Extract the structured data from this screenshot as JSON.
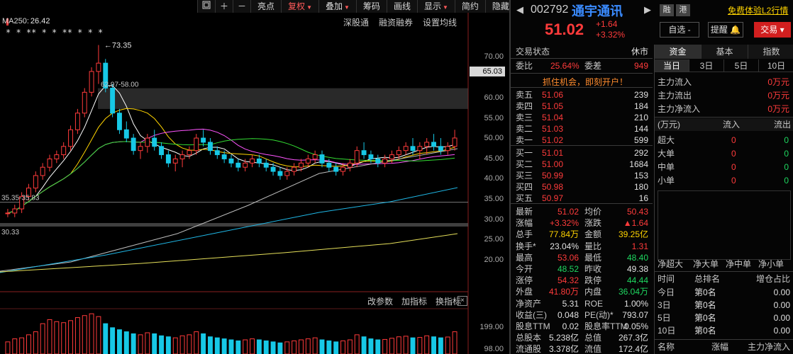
{
  "toolbar": {
    "icons": [
      "window-icon",
      "plus-icon",
      "minus-icon"
    ],
    "items": [
      "亮点",
      "复权",
      "叠加",
      "筹码",
      "画线",
      "显示",
      "简约",
      "隐藏"
    ],
    "highlight_index": 1,
    "dropdown_indices": [
      1,
      2,
      5
    ]
  },
  "chart": {
    "ma_label": "MA250:",
    "ma_value": "26.42",
    "links": [
      "深股通",
      "融资融券",
      "设置均线"
    ],
    "sub_links": [
      "改参数",
      "加指标",
      "换指标"
    ],
    "close_icon": "×",
    "price_tag": "65.03",
    "y_ticks": [
      "70.00",
      "60.00",
      "55.00",
      "50.00",
      "45.00",
      "40.00",
      "35.00",
      "30.00",
      "25.00",
      "20.00"
    ],
    "vol_ticks": [
      "199.00",
      "98.00"
    ],
    "high_annotation": "73.35",
    "gap_label": "62.97-58.00",
    "gap2_label": "35.35-35.83",
    "low_left_label": "30.33",
    "star_marks": "** * * * ** * *"
  },
  "chart_data": {
    "type": "candlestick",
    "ylim": [
      17,
      76
    ],
    "last_price": 65.03,
    "candles": [
      [
        33,
        34,
        32,
        33
      ],
      [
        33,
        35,
        32,
        34
      ],
      [
        34,
        38,
        33,
        37
      ],
      [
        37,
        40,
        36,
        39
      ],
      [
        39,
        43,
        38,
        42
      ],
      [
        42,
        45,
        41,
        44
      ],
      [
        44,
        47,
        43,
        46
      ],
      [
        46,
        48,
        45,
        47
      ],
      [
        47,
        50,
        46,
        49
      ],
      [
        49,
        54,
        48,
        53
      ],
      [
        53,
        58,
        52,
        57
      ],
      [
        57,
        63,
        56,
        62
      ],
      [
        62,
        68,
        61,
        67
      ],
      [
        67,
        73.35,
        64,
        69
      ],
      [
        69,
        70,
        62,
        63
      ],
      [
        63,
        64,
        56,
        57
      ],
      [
        57,
        58,
        52,
        53
      ],
      [
        53,
        55,
        50,
        51
      ],
      [
        51,
        52,
        47,
        48
      ],
      [
        48,
        50,
        46,
        49
      ],
      [
        49,
        52,
        47.5,
        51
      ],
      [
        51,
        53,
        48,
        49
      ],
      [
        49,
        50,
        46,
        47
      ],
      [
        47,
        48,
        44,
        45
      ],
      [
        45,
        47,
        43,
        46
      ],
      [
        46,
        48,
        44,
        47
      ],
      [
        47,
        49,
        46,
        48
      ],
      [
        48,
        52,
        47,
        51
      ],
      [
        51,
        53,
        49,
        50
      ],
      [
        50,
        51,
        47,
        48
      ],
      [
        48,
        49,
        46,
        47
      ],
      [
        47,
        48,
        45,
        46
      ],
      [
        46,
        47,
        44,
        45
      ],
      [
        45,
        46,
        43,
        44
      ],
      [
        44,
        46,
        43,
        45
      ],
      [
        45,
        47,
        44,
        46
      ],
      [
        46,
        47,
        44,
        45
      ],
      [
        45,
        46,
        43,
        44
      ],
      [
        44,
        45,
        42,
        43
      ],
      [
        43,
        44,
        41,
        42
      ],
      [
        42,
        44,
        41,
        43
      ],
      [
        43,
        45,
        42,
        44
      ],
      [
        44,
        46,
        43,
        45
      ],
      [
        45,
        47,
        44,
        46
      ],
      [
        46,
        48,
        45,
        47
      ],
      [
        47,
        48,
        44,
        45
      ],
      [
        45,
        46,
        43,
        44
      ],
      [
        44,
        45,
        42,
        43
      ],
      [
        43,
        45,
        42,
        44
      ],
      [
        44,
        46,
        43,
        45
      ],
      [
        45,
        49,
        44,
        48
      ],
      [
        48,
        50,
        46,
        47
      ],
      [
        47,
        48,
        45,
        46
      ],
      [
        46,
        47,
        44,
        45
      ],
      [
        45,
        47,
        44,
        46
      ],
      [
        46,
        48,
        45,
        47
      ],
      [
        47,
        49,
        46,
        48
      ],
      [
        48,
        50,
        47,
        49
      ],
      [
        49,
        51,
        47,
        48
      ],
      [
        48,
        50,
        46,
        49
      ],
      [
        49,
        51,
        47,
        50
      ],
      [
        50,
        52,
        48,
        49
      ],
      [
        49,
        51,
        47,
        48
      ],
      [
        48,
        50,
        47,
        49
      ],
      [
        49,
        53,
        48,
        51.02
      ]
    ],
    "volumes": [
      60,
      75,
      80,
      95,
      110,
      150,
      170,
      160,
      155,
      165,
      180,
      190,
      199,
      185,
      150,
      130,
      120,
      110,
      100,
      95,
      105,
      100,
      90,
      85,
      80,
      90,
      95,
      110,
      100,
      85,
      80,
      75,
      70,
      65,
      70,
      75,
      70,
      65,
      60,
      55,
      60,
      65,
      70,
      75,
      80,
      70,
      65,
      60,
      65,
      70,
      95,
      85,
      75,
      70,
      72,
      78,
      85,
      88,
      80,
      82,
      90,
      85,
      80,
      84,
      110
    ],
    "series": [
      {
        "name": "MA5",
        "color": "#ffffff"
      },
      {
        "name": "MA10",
        "color": "#ffd400"
      },
      {
        "name": "MA20",
        "color": "#ff55ff"
      },
      {
        "name": "MA30",
        "color": "#33dd33"
      },
      {
        "name": "MA60",
        "color": "#bbbbbb"
      },
      {
        "name": "MA120",
        "color": "#1fb7e6"
      },
      {
        "name": "MA250",
        "color": "#e6e05a"
      }
    ]
  },
  "header": {
    "code": "002792",
    "name": "通宇通讯",
    "btn_rong": "融",
    "btn_gang": "港",
    "free_link": "免费体验L2行情",
    "price": "51.02",
    "change": "+1.64",
    "change_pct": "+3.32%",
    "watch_btn": "自选 -",
    "remind_btn": "提醒",
    "trade_btn": "交易"
  },
  "orderbook": {
    "status_label": "交易状态",
    "status_value": "休市",
    "webi_label": "委比",
    "webi_value": "25.64%",
    "weicha_label": "委差",
    "weicha_value": "949",
    "promo": "抓住机会，即刻开户！",
    "sells": [
      {
        "label": "卖五",
        "price": "51.06",
        "vol": "239"
      },
      {
        "label": "卖四",
        "price": "51.05",
        "vol": "184"
      },
      {
        "label": "卖三",
        "price": "51.04",
        "vol": "210"
      },
      {
        "label": "卖二",
        "price": "51.03",
        "vol": "144"
      },
      {
        "label": "卖一",
        "price": "51.02",
        "vol": "599"
      }
    ],
    "buys": [
      {
        "label": "买一",
        "price": "51.01",
        "vol": "292"
      },
      {
        "label": "买二",
        "price": "51.00",
        "vol": "1684"
      },
      {
        "label": "买三",
        "price": "50.99",
        "vol": "153"
      },
      {
        "label": "买四",
        "price": "50.98",
        "vol": "180"
      },
      {
        "label": "买五",
        "price": "50.97",
        "vol": "16"
      }
    ],
    "quotes": [
      {
        "k1": "最新",
        "v1": "51.02",
        "c1": "red",
        "k2": "均价",
        "v2": "50.43",
        "c2": "red"
      },
      {
        "k1": "涨幅",
        "v1": "+3.32%",
        "c1": "red",
        "k2": "涨跌",
        "v2": "▲1.64",
        "c2": "red"
      },
      {
        "k1": "总手",
        "v1": "77.84万",
        "c1": "ylw",
        "k2": "金额",
        "v2": "39.25亿",
        "c2": "ylw"
      },
      {
        "k1": "换手*",
        "v1": "23.04%",
        "c1": "wht",
        "k2": "量比",
        "v2": "1.31",
        "c2": "red"
      },
      {
        "k1": "最高",
        "v1": "53.06",
        "c1": "red",
        "k2": "最低",
        "v2": "48.40",
        "c2": "grn"
      },
      {
        "k1": "今开",
        "v1": "48.52",
        "c1": "grn",
        "k2": "昨收",
        "v2": "49.38",
        "c2": "wht"
      },
      {
        "k1": "涨停",
        "v1": "54.32",
        "c1": "red",
        "k2": "跌停",
        "v2": "44.44",
        "c2": "grn"
      },
      {
        "k1": "外盘",
        "v1": "41.80万",
        "c1": "red",
        "k2": "内盘",
        "v2": "36.04万",
        "c2": "grn"
      },
      {
        "k1": "净资产",
        "v1": "5.31",
        "c1": "wht",
        "k2": "ROE",
        "v2": "1.00%",
        "c2": "wht"
      },
      {
        "k1": "收益(三)",
        "v1": "0.048",
        "c1": "wht",
        "k2": "PE(动)*",
        "v2": "793.07",
        "c2": "wht"
      },
      {
        "k1": "股息TTM",
        "v1": "0.02",
        "c1": "wht",
        "k2": "股息率TTM",
        "v2": "0.05%",
        "c2": "wht"
      },
      {
        "k1": "总股本",
        "v1": "5.238亿",
        "c1": "wht",
        "k2": "总值",
        "v2": "267.3亿",
        "c2": "wht"
      },
      {
        "k1": "流通股",
        "v1": "3.378亿",
        "c1": "wht",
        "k2": "流值",
        "v2": "172.4亿",
        "c2": "wht"
      }
    ]
  },
  "capflow": {
    "tabs": [
      "资金",
      "基本",
      "指数"
    ],
    "periods": [
      "当日",
      "3日",
      "5日",
      "10日"
    ],
    "flows": [
      {
        "k": "主力流入",
        "v": "0万元"
      },
      {
        "k": "主力流出",
        "v": "0万元"
      },
      {
        "k": "主力净流入",
        "v": "0万元"
      }
    ],
    "grid_header": [
      "(万元)",
      "流入",
      "流出"
    ],
    "grid": [
      {
        "k": "超大",
        "in": "0",
        "out": "0"
      },
      {
        "k": "大单",
        "in": "0",
        "out": "0"
      },
      {
        "k": "中单",
        "in": "0",
        "out": "0"
      },
      {
        "k": "小单",
        "in": "0",
        "out": "0"
      }
    ],
    "net_labels": [
      "净超大",
      "净大单",
      "净中单",
      "净小单"
    ],
    "rank_header": [
      "时间",
      "总排名",
      "增仓占比"
    ],
    "ranks": [
      {
        "t": "今日",
        "r": "第0名",
        "p": "0.00"
      },
      {
        "t": "3日",
        "r": "第0名",
        "p": "0.00"
      },
      {
        "t": "5日",
        "r": "第0名",
        "p": "0.00"
      },
      {
        "t": "10日",
        "r": "第0名",
        "p": "0.00"
      }
    ],
    "bottom_header": [
      "名称",
      "涨幅",
      "主力净流入"
    ]
  }
}
